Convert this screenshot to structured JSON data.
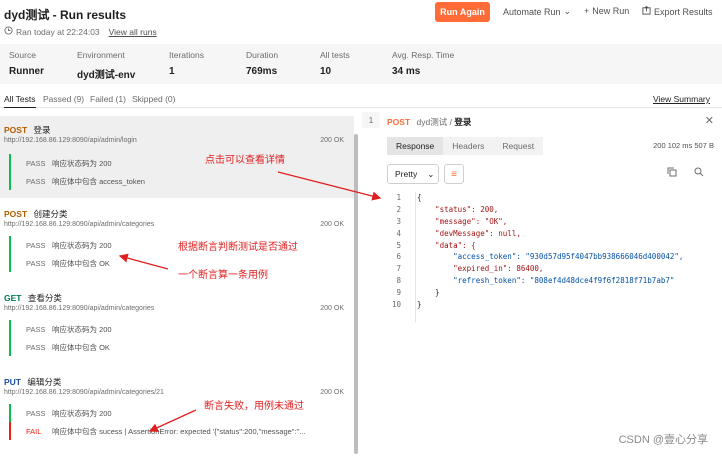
{
  "header": {
    "title": "dyd测试 - Run results",
    "ran_text": "Ran today at 22:24:03",
    "view_all": "View all runs",
    "run_again": "Run Again",
    "automate_run": "Automate Run",
    "new_run": "New Run",
    "export_results": "Export Results"
  },
  "summary": [
    {
      "label": "Source",
      "value": "Runner"
    },
    {
      "label": "Environment",
      "value": "dyd测试-env"
    },
    {
      "label": "Iterations",
      "value": "1"
    },
    {
      "label": "Duration",
      "value": "769ms"
    },
    {
      "label": "All tests",
      "value": "10"
    },
    {
      "label": "Avg. Resp. Time",
      "value": "34 ms"
    }
  ],
  "tabs": [
    {
      "label": "All Tests"
    },
    {
      "label": "Passed (9)"
    },
    {
      "label": "Failed (1)"
    },
    {
      "label": "Skipped (0)"
    }
  ],
  "view_summary": "View Summary",
  "requests": [
    {
      "method": "POST",
      "name": "登录",
      "url": "http://192.168.86.129:8090/api/admin/login",
      "status": "200 OK",
      "tests": [
        {
          "status": "PASS",
          "text": "响应状态码为 200"
        },
        {
          "status": "PASS",
          "text": "响应体中包含 access_token"
        }
      ]
    },
    {
      "method": "POST",
      "name": "创建分类",
      "url": "http://192.168.86.129:8090/api/admin/categories",
      "status": "200 OK",
      "tests": [
        {
          "status": "PASS",
          "text": "响应状态码为 200"
        },
        {
          "status": "PASS",
          "text": "响应体中包含 OK"
        }
      ]
    },
    {
      "method": "GET",
      "name": "查看分类",
      "url": "http://192.168.86.129:8090/api/admin/categories",
      "status": "200 OK",
      "tests": [
        {
          "status": "PASS",
          "text": "响应状态码为 200"
        },
        {
          "status": "PASS",
          "text": "响应体中包含 OK"
        }
      ]
    },
    {
      "method": "PUT",
      "name": "编辑分类",
      "url": "http://192.168.86.129:8090/api/admin/categories/21",
      "status": "200 OK",
      "tests": [
        {
          "status": "PASS",
          "text": "响应状态码为 200"
        },
        {
          "status": "FAIL",
          "text": "响应体中包含 sucess | AssertionError: expected '{\"status\":200,\"message\":\"..."
        }
      ]
    }
  ],
  "annotations": {
    "a1": "点击可以查看详情",
    "a2": "根据断言判断测试是否通过",
    "a3": "一个断言算一条用例",
    "a4": "断言失败，用例未通过"
  },
  "detail": {
    "iteration": "1",
    "method": "POST",
    "collection": "dyd测试",
    "request": "登录",
    "tabs": [
      "Response",
      "Headers",
      "Request"
    ],
    "meta": "200   102 ms   507 B",
    "format": "Pretty",
    "code_lines": [
      {
        "n": "1",
        "t": "{"
      },
      {
        "n": "2",
        "t": "    \"status\": 200,"
      },
      {
        "n": "3",
        "t": "    \"message\": \"OK\","
      },
      {
        "n": "4",
        "t": "    \"devMessage\": null,"
      },
      {
        "n": "5",
        "t": "    \"data\": {"
      },
      {
        "n": "6",
        "t": "        \"access_token\": \"930d57d95f4047bb938666046d400042\","
      },
      {
        "n": "7",
        "t": "        \"expired_in\": 86400,"
      },
      {
        "n": "8",
        "t": "        \"refresh_token\": \"808ef4d48dce4f9f6f2818f71b7ab7\""
      },
      {
        "n": "9",
        "t": "    }"
      },
      {
        "n": "10",
        "t": "}"
      }
    ]
  },
  "watermark": "CSDN @壹心分享",
  "colors": {
    "accent": "#ff6c37",
    "pass": "#0cbb52",
    "fail": "#eb2013",
    "annotation": "#e02020"
  }
}
